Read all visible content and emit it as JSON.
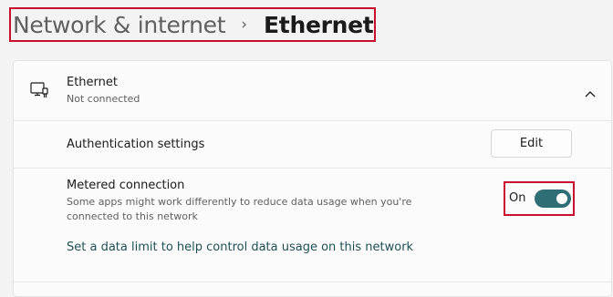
{
  "breadcrumb": {
    "parent": "Network & internet",
    "separator": "›",
    "current": "Ethernet"
  },
  "ethernet": {
    "icon": "ethernet-icon",
    "title": "Ethernet",
    "status": "Not connected",
    "expand_icon": "chevron-up-icon"
  },
  "auth": {
    "label": "Authentication settings",
    "button": "Edit"
  },
  "metered": {
    "title": "Metered connection",
    "description": "Some apps might work differently to reduce data usage when you're connected to this network",
    "toggle_label": "On",
    "toggle_on": true
  },
  "data_limit_link": "Set a data limit to help control data usage on this network",
  "colors": {
    "accent": "#2f6e74",
    "highlight": "#c8102e",
    "background": "#f3f3f3"
  }
}
